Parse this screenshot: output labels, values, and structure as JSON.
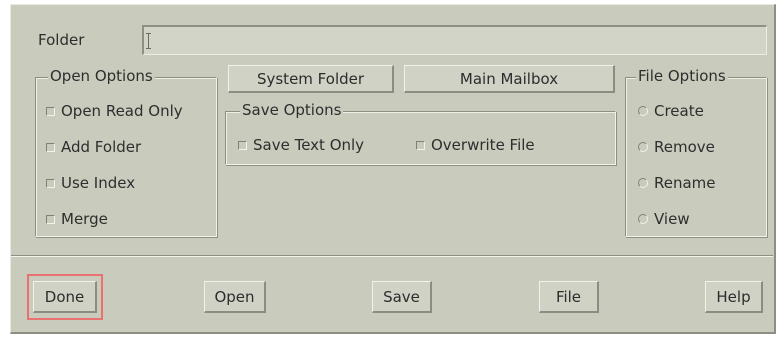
{
  "folder": {
    "label": "Folder",
    "value": ""
  },
  "open_options": {
    "title": "Open Options",
    "items": [
      "Open Read Only",
      "Add Folder",
      "Use Index",
      "Merge"
    ]
  },
  "top_buttons": {
    "system_folder": "System Folder",
    "main_mailbox": "Main Mailbox"
  },
  "save_options": {
    "title": "Save Options",
    "items": [
      "Save Text Only",
      "Overwrite File"
    ]
  },
  "file_options": {
    "title": "File Options",
    "items": [
      "Create",
      "Remove",
      "Rename",
      "View"
    ]
  },
  "bottom_buttons": {
    "done": "Done",
    "open": "Open",
    "save": "Save",
    "file": "File",
    "help": "Help"
  },
  "colors": {
    "dialog_bg": "#c9cbbd",
    "focus_ring": "#e97171"
  },
  "icons": {
    "checkbox": "checkbox-icon",
    "radio": "radio-icon"
  }
}
